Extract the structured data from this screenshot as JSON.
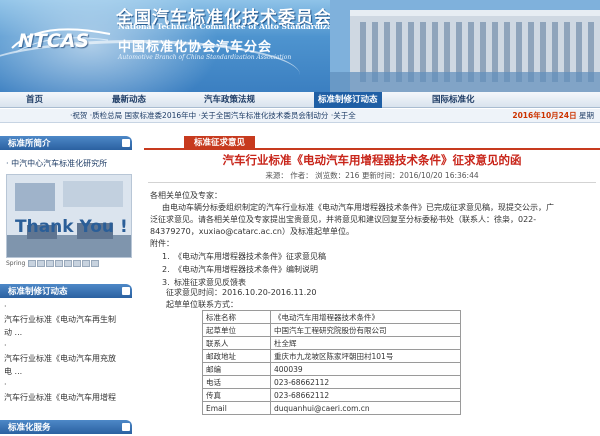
{
  "header": {
    "logo": "NTCAS",
    "title_cn": "全国汽车标准化技术委员会",
    "title_en": "National Technical Committee of Auto Standardization",
    "subtitle_cn": "中国标准化协会汽车分会",
    "subtitle_en": "Automotive Branch of China Standardization Association"
  },
  "nav": {
    "items": [
      {
        "label": "首页"
      },
      {
        "label": "最新动态"
      },
      {
        "label": "汽车政策法规"
      },
      {
        "label": "标准制修订动态"
      },
      {
        "label": "国际标准化"
      }
    ],
    "active_index": 3
  },
  "ticker": {
    "items": [
      "·祝贺",
      "·质检总局 国家标准委2016年中",
      "·关于全国汽车标准化技术委员会制动分",
      "·关于全"
    ],
    "date": "2016年10月24日",
    "weekday": "星期"
  },
  "sidebar": {
    "intro_head": "标准所简介",
    "intro_link": "· 中汽中心汽车标准化研究所",
    "thumb_text": "Thank You !",
    "thumb_controls": "Spring",
    "std_head": "标准制修订动态",
    "std_items": [
      "·",
      "汽车行业标准《电动汽车再生制",
      "动 ...",
      "·",
      "汽车行业标准《电动汽车用充放",
      "电 ...",
      "·",
      "汽车行业标准《电动汽车用增程"
    ],
    "bottom_head": "标准化服务"
  },
  "main": {
    "section_label": "标准征求意见",
    "article_title": "汽车行业标准《电动汽车用增程器技术条件》征求意见的函",
    "meta": "来源：   作者：   浏览数：216   更新时间：2016/10/20 16:36:44",
    "greeting": "各相关单位及专家：",
    "body_line1": "由电动车辆分标委组织制定的汽车行业标准《电动汽车用增程器技术条件》已完成征求意见稿，现提交公示，广",
    "body_line2": "泛征求意见。请各相关单位及专家提出宝贵意见，并将意见和建议回复至分标委秘书处（联系人：徐枭，022-",
    "body_line3": "84379270，xuxiao@catarc.ac.cn）及标准起草单位。",
    "attach_label": "附件：",
    "attachments": [
      {
        "num": "1.",
        "text": "《电动汽车用增程器技术条件》征求意见稿"
      },
      {
        "num": "2.",
        "text": "《电动汽车用增程器技术条件》编制说明"
      },
      {
        "num": "3.",
        "text": "标准征求意见反馈表"
      }
    ],
    "period": "征求意见时间：2016.10.20-2016.11.20",
    "contact_label": "起草单位联系方式：",
    "contact_rows": [
      {
        "k": "标准名称",
        "v": "《电动汽车用增程器技术条件》"
      },
      {
        "k": "起草单位",
        "v": "中国汽车工程研究院股份有限公司"
      },
      {
        "k": "联系人",
        "v": "杜全辉"
      },
      {
        "k": "邮政地址",
        "v": "重庆市九龙坡区陈家坪朝田村101号"
      },
      {
        "k": "邮编",
        "v": "400039"
      },
      {
        "k": "电话",
        "v": "023-68662112"
      },
      {
        "k": "传真",
        "v": "023-68662112"
      },
      {
        "k": "Email",
        "v": "duquanhui@caeri.com.cn"
      }
    ]
  },
  "colors": {
    "banner_blue": "#3b7fc1",
    "nav_active": "#1f5fa5",
    "title_red": "#c8251a",
    "section_red": "#c73a1e"
  }
}
